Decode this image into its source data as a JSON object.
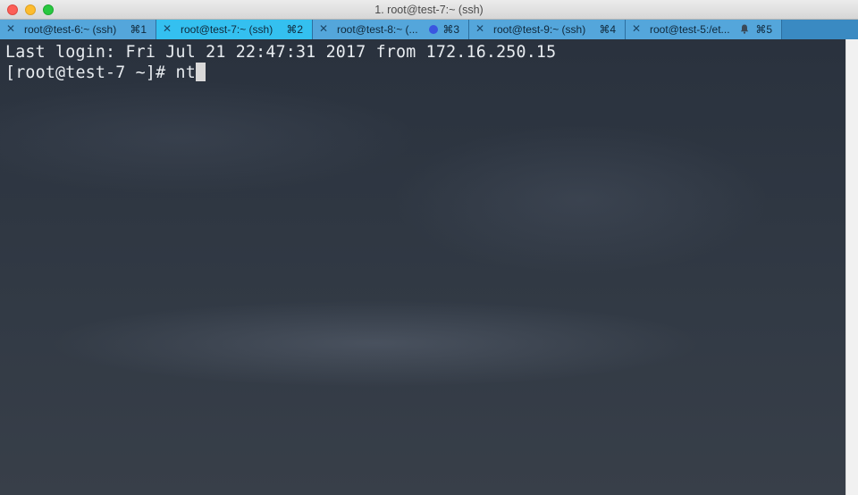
{
  "window": {
    "title": "1. root@test-7:~ (ssh)"
  },
  "tabs": [
    {
      "label": "root@test-6:~ (ssh)",
      "shortcut": "⌘1",
      "active": false
    },
    {
      "label": "root@test-7:~ (ssh)",
      "shortcut": "⌘2",
      "active": true
    },
    {
      "label": "root@test-8:~ (...",
      "shortcut": "⌘3",
      "active": false,
      "indicator": "activity-dot"
    },
    {
      "label": "root@test-9:~ (ssh)",
      "shortcut": "⌘4",
      "active": false
    },
    {
      "label": "root@test-5:/et...",
      "shortcut": "⌘5",
      "active": false,
      "indicator": "bell-icon"
    }
  ],
  "terminal": {
    "lines": [
      "Last login: Fri Jul 21 22:47:31 2017 from 172.16.250.15",
      "[root@test-7 ~]# nt"
    ]
  },
  "colors": {
    "tab_active": "#34c0f0",
    "tab_inactive": "#54a6db",
    "terminal_text": "#e8ecf0",
    "activity_dot": "#3a55e0"
  }
}
